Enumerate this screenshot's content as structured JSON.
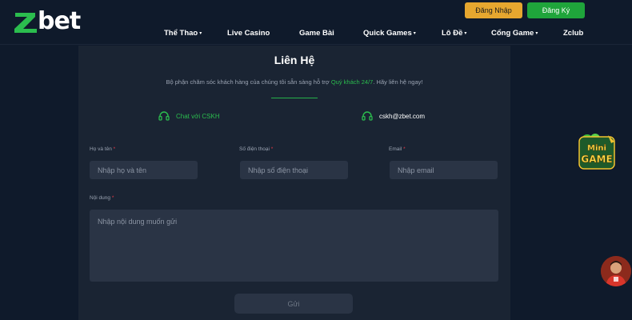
{
  "brand": {
    "logo_text": "bet",
    "accent": "#1fa53b"
  },
  "header": {
    "login_label": "Đăng Nhập",
    "register_label": "Đăng Ký",
    "nav": [
      {
        "label": "Thể Thao",
        "caret": "▾"
      },
      {
        "label": "Live Casino",
        "caret": ""
      },
      {
        "label": "Game Bài",
        "caret": ""
      },
      {
        "label": "Quick Games",
        "caret": "▾"
      },
      {
        "label": "Lô Đề",
        "caret": "▾"
      },
      {
        "label": "Cổng Game",
        "caret": "▾"
      },
      {
        "label": "Zclub",
        "caret": ""
      }
    ]
  },
  "contact_page": {
    "title": "Liên Hệ",
    "subtitle_before": "Bộ phận chăm sóc khách hàng của chúng tôi sẵn sàng hỗ trợ ",
    "subtitle_highlight": "Quý khách 24/7",
    "subtitle_after": ". Hãy liên hệ ngay!",
    "chat_label": "Chat với CSKH",
    "email_value": "cskh@zbet.com",
    "form": {
      "name_label": "Họ và tên",
      "name_placeholder": "Nhập họ và tên",
      "phone_label": "Số điện thoại",
      "phone_placeholder": "Nhập số điện thoại",
      "email_label": "Email",
      "email_placeholder": "Nhập email",
      "content_label": "Nội dung",
      "content_placeholder": "Nhập nội dung muốn gửi",
      "required_mark": "*",
      "submit_label": "Gửi"
    }
  },
  "widgets": {
    "minigame_line1": "Mini",
    "minigame_line2": "GAME"
  }
}
